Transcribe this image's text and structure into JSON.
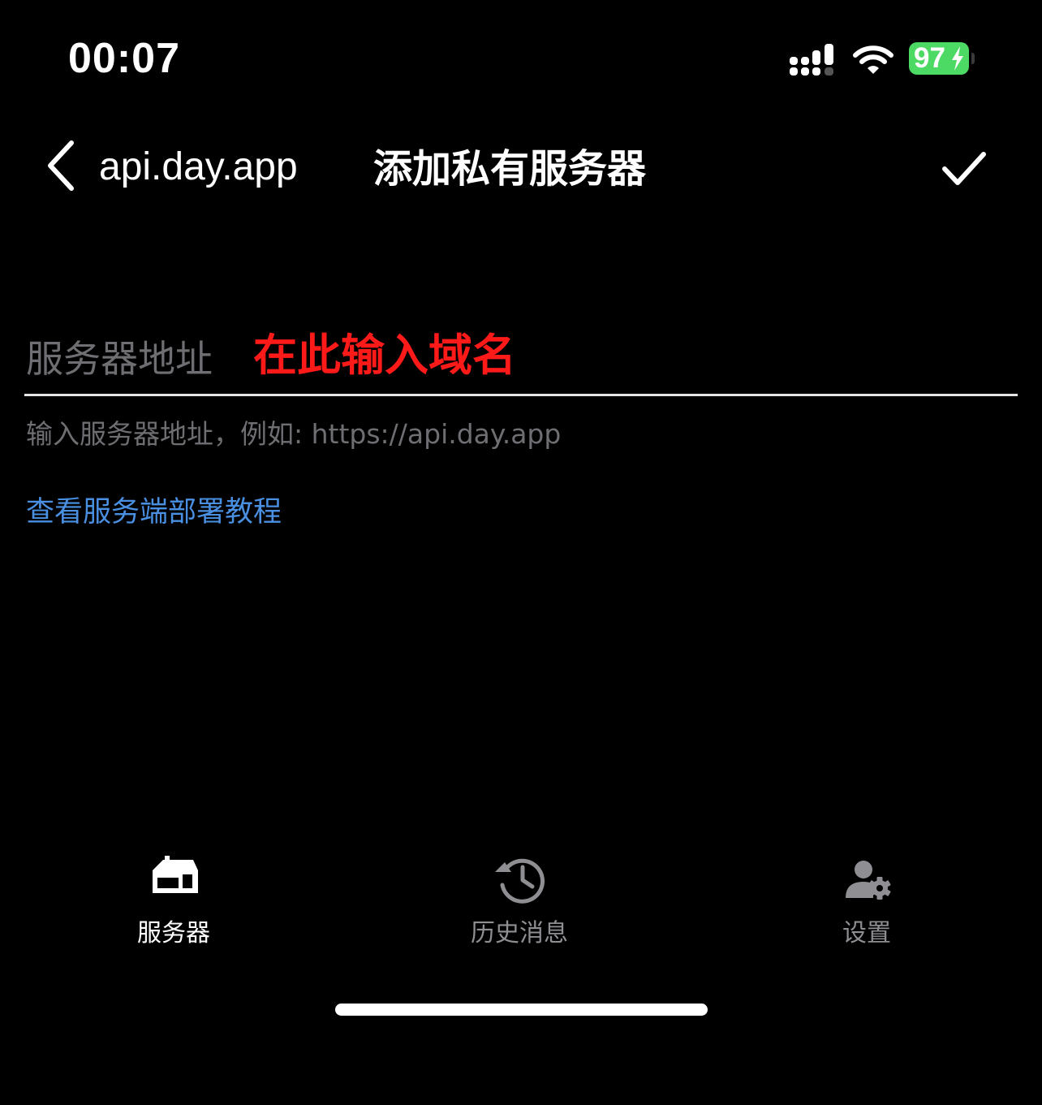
{
  "status_bar": {
    "time": "00:07",
    "battery_level": "97",
    "battery_color": "#4cd964"
  },
  "nav": {
    "back_label": "api.day.app",
    "title": "添加私有服务器",
    "back_icon": "chevron-left-icon",
    "confirm_icon": "checkmark-icon"
  },
  "form": {
    "field_label": "服务器地址",
    "field_value": "",
    "field_placeholder": "在此输入域名",
    "field_placeholder_color": "#ff1a1a",
    "helper_text": "输入服务器地址，例如: https://api.day.app",
    "tutorial_link": "查看服务端部署教程",
    "link_color": "#4a90e2"
  },
  "tab_bar": {
    "tabs": [
      {
        "label": "服务器",
        "icon": "server-icon",
        "active": true
      },
      {
        "label": "历史消息",
        "icon": "history-icon",
        "active": false
      },
      {
        "label": "设置",
        "icon": "user-settings-icon",
        "active": false
      }
    ]
  }
}
